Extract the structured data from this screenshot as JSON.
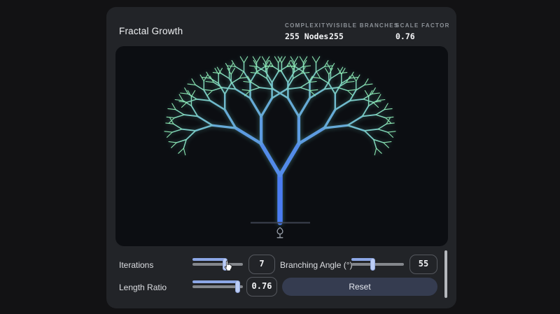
{
  "app": {
    "title": "Fractal Growth"
  },
  "stats": [
    {
      "label": "COMPLEXITY",
      "value": "255 Nodes"
    },
    {
      "label": "VISIBLE BRANCHES",
      "value": "255"
    },
    {
      "label": "SCALE FACTOR",
      "value": "0.76"
    }
  ],
  "tree": {
    "type": "fractal-tree",
    "iterations": 7,
    "branching_angle_deg": 55,
    "length_ratio": 0.76,
    "branch_count": 255,
    "trunk_color": "#4a7cf2",
    "tip_color": "#8ce8b2",
    "glow_color": "#69c8be",
    "ground_color": "#3d4250",
    "icon_color": "#99a0aa"
  },
  "controls": {
    "iterations": {
      "label": "Iterations",
      "value": "7",
      "fill": 0.65
    },
    "branching_angle": {
      "label": "Branching Angle (°)",
      "value": "55",
      "fill": 0.41
    },
    "length_ratio": {
      "label": "Length Ratio",
      "value": "0.76",
      "fill": 0.9
    },
    "reset_label": "Reset"
  }
}
